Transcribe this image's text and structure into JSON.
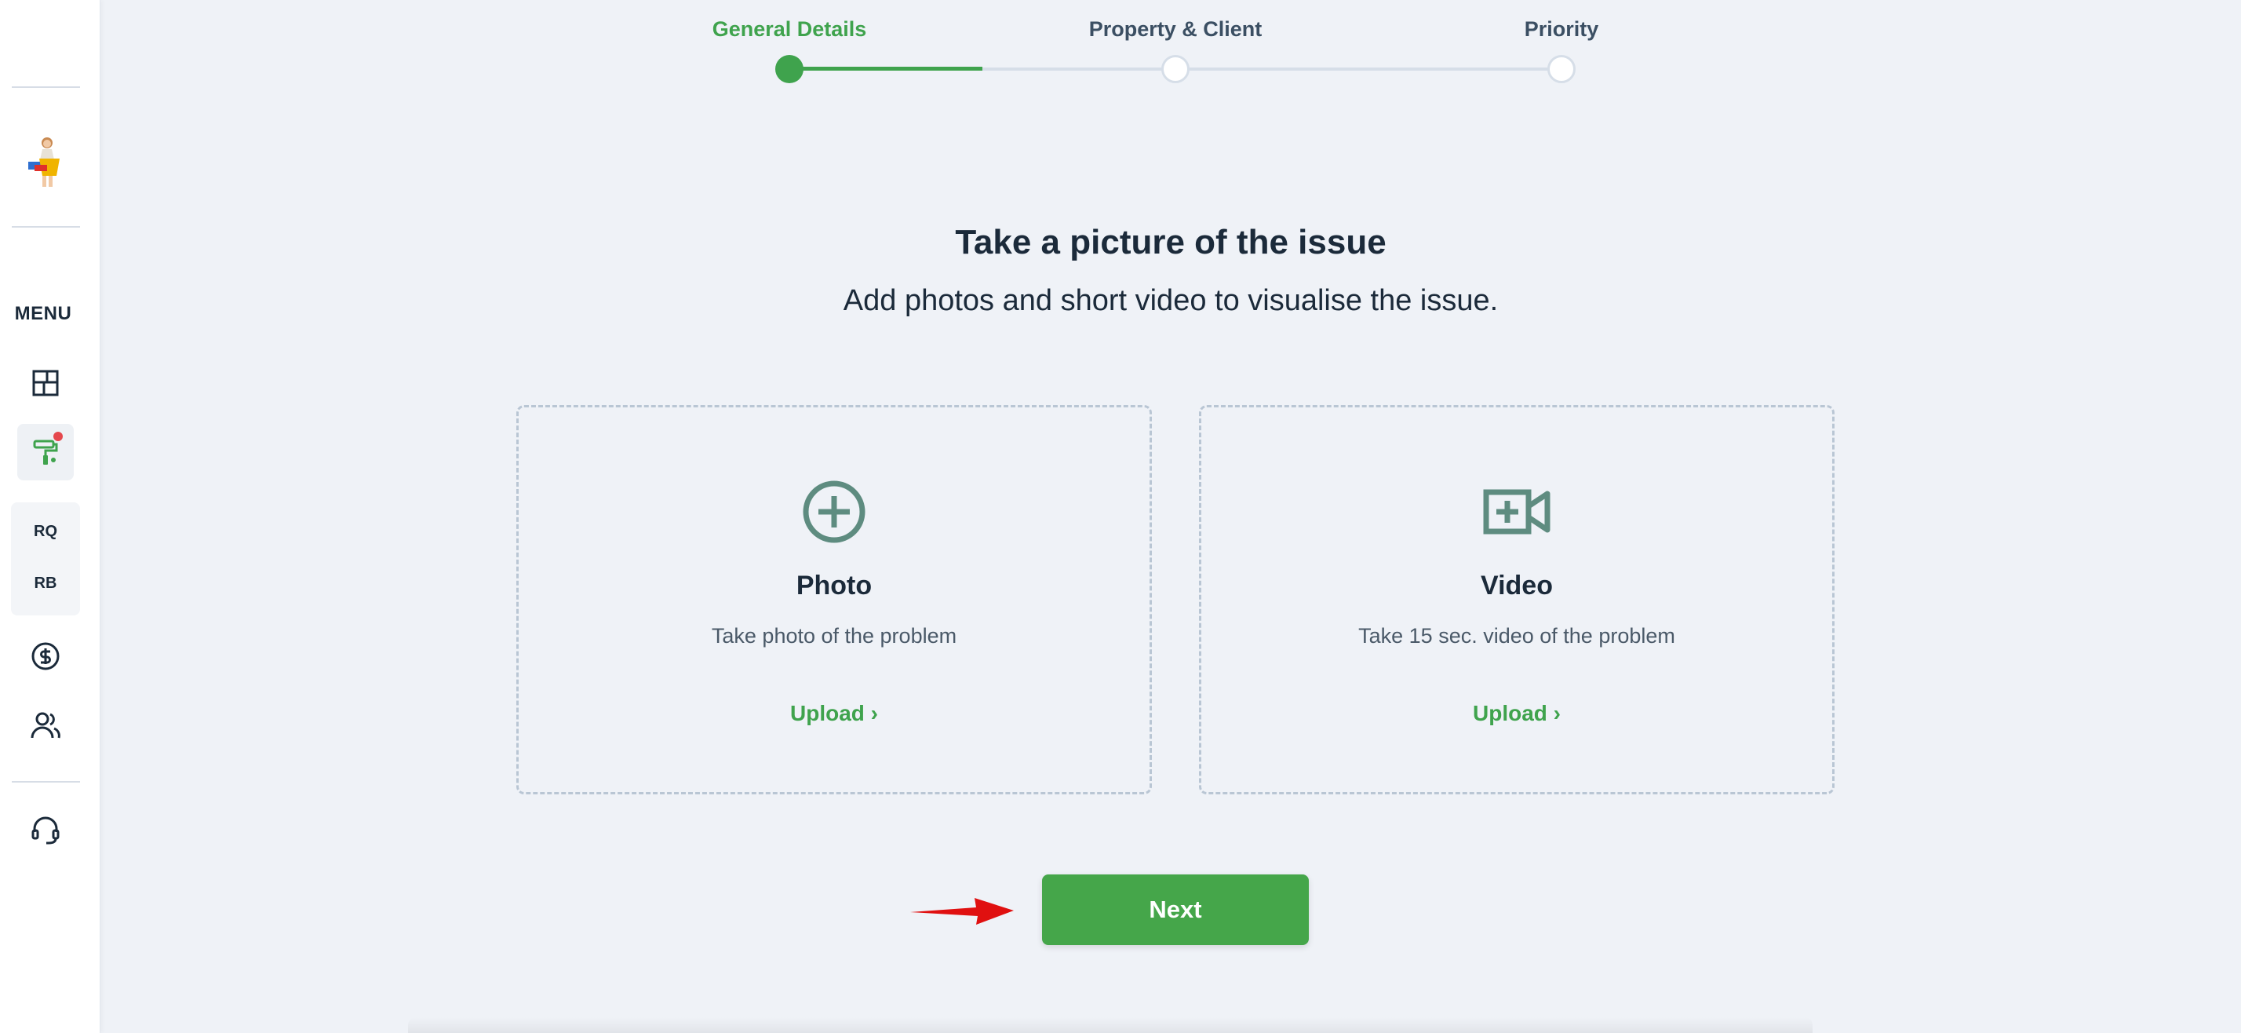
{
  "sidebar": {
    "menu_label": "MENU",
    "group_items": [
      "RQ",
      "RB"
    ],
    "icons": [
      "dashboard-icon",
      "paint-roller-icon",
      "dollar-icon",
      "users-icon",
      "support-headset-icon"
    ],
    "notification_color": "#e5484d"
  },
  "stepper": {
    "steps": [
      {
        "label": "General Details",
        "state": "active"
      },
      {
        "label": "Property & Client",
        "state": "todo"
      },
      {
        "label": "Priority",
        "state": "todo"
      }
    ],
    "progress_fraction": 0.25,
    "active_color": "#3fa34d",
    "inactive_label_color": "#3b4f63"
  },
  "main": {
    "title": "Take a picture of the issue",
    "subtitle": "Add photos and short video to visualise the issue."
  },
  "cards": [
    {
      "icon": "plus-circle-icon",
      "title": "Photo",
      "description": "Take photo of the problem",
      "link": "Upload ›"
    },
    {
      "icon": "video-plus-icon",
      "title": "Video",
      "description": "Take 15 sec. video of the problem",
      "link": "Upload ›"
    }
  ],
  "actions": {
    "next_label": "Next",
    "button_color": "#45a64a"
  },
  "colors": {
    "accent": "#3fa34d",
    "icon_teal": "#5e8c80",
    "background": "#eff2f7",
    "arrow_annotation": "#e01010"
  }
}
